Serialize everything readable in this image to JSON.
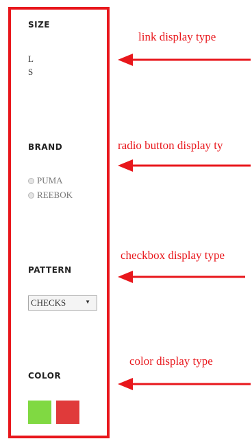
{
  "filters": {
    "size": {
      "heading": "SIZE",
      "items": [
        "L",
        "S"
      ]
    },
    "brand": {
      "heading": "BRAND",
      "items": [
        "PUMA",
        "REEBOK"
      ]
    },
    "pattern": {
      "heading": "PATTERN",
      "selected": "CHECKS"
    },
    "color": {
      "heading": "COLOR",
      "swatches": [
        "#80d942",
        "#e03a3a"
      ]
    }
  },
  "annotations": {
    "link": "link display type",
    "radio": "radio button display ty",
    "checkbox": "checkbox display type",
    "color": "color display type"
  },
  "colors": {
    "accent": "#e8171c"
  }
}
